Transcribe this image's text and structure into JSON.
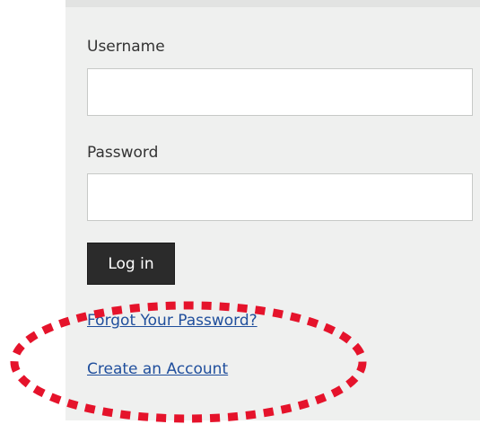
{
  "login_form": {
    "username_label": "Username",
    "username_value": "",
    "password_label": "Password",
    "password_value": "",
    "login_button_label": "Log in",
    "forgot_password_link": "Forgot Your Password?",
    "create_account_link": "Create an Account"
  },
  "colors": {
    "panel_background": "#eff0ef",
    "button_background": "#2b2b2b",
    "link": "#1f4e9c",
    "highlight": "#e5132b"
  }
}
